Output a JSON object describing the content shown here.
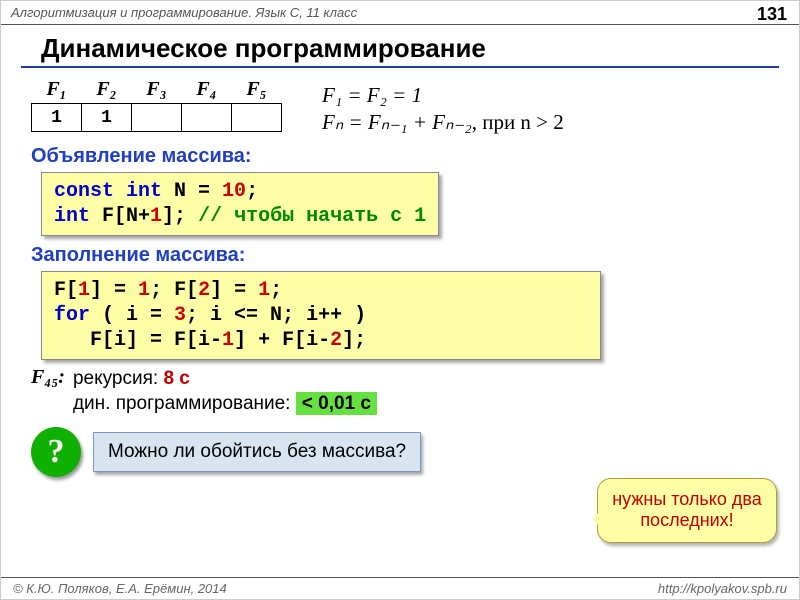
{
  "header": {
    "breadcrumb": "Алгоритмизация и программирование. Язык C, 11 класс",
    "page": "131"
  },
  "title": "Динамическое программирование",
  "fib": {
    "headers": [
      "F₁",
      "F₂",
      "F₃",
      "F₄",
      "F₅"
    ],
    "cells": [
      "1",
      "1",
      "",
      "",
      ""
    ]
  },
  "formula": {
    "line1": "F₁ = F₂ = 1",
    "line2_lhs": "Fₙ = Fₙ₋₁ + Fₙ₋₂",
    "line2_rhs": ", при n > 2"
  },
  "sections": {
    "decl": "Объявление массива:",
    "fill": "Заполнение массива:"
  },
  "code1": {
    "l1a": "const int",
    "l1b": " N = ",
    "l1c": "10",
    "l1d": ";",
    "l2a": "int",
    "l2b": " F[N+",
    "l2c": "1",
    "l2d": "]; ",
    "l2e": "// чтобы начать с 1"
  },
  "code2": {
    "l1a": "F[",
    "l1b": "1",
    "l1c": "] = ",
    "l1d": "1",
    "l1e": "; F[",
    "l1f": "2",
    "l1g": "] = ",
    "l1h": "1",
    "l1i": ";",
    "l2a": "for",
    "l2b": " ( i = ",
    "l2c": "3",
    "l2d": "; i <= N; i++ )",
    "l3a": "   F[i] = F[i-",
    "l3b": "1",
    "l3c": "] + F[i-",
    "l3d": "2",
    "l3e": "];"
  },
  "f45": {
    "label": "F₄₅:",
    "rec_label": "рекурсия: ",
    "rec_time": "8 с",
    "dp_label": "дин. программирование: ",
    "dp_time": "< 0,01 с"
  },
  "question": {
    "mark": "?",
    "text": "Можно ли обойтись без массива?"
  },
  "callout": "нужны только два последних!",
  "footer": {
    "left": "© К.Ю. Поляков, Е.А. Ерёмин, 2014",
    "right": "http://kpolyakov.spb.ru"
  }
}
